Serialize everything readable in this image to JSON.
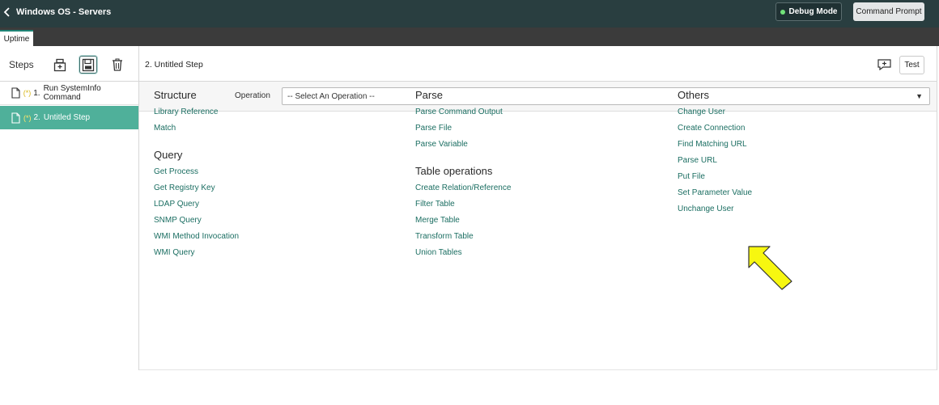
{
  "header": {
    "back_icon": "chevron-left-icon",
    "title": "Windows OS - Servers",
    "debug_mode": "Debug Mode",
    "debug_color": "#71e279",
    "command_prompt": "Command Prompt"
  },
  "tabs": [
    {
      "label": "Uptime",
      "active": true
    }
  ],
  "sidebar": {
    "label": "Steps",
    "tools": [
      "insert-step-icon",
      "save-step-icon",
      "trash-icon"
    ],
    "steps": [
      {
        "star": "(*)",
        "number": "1.",
        "name": "Run SystemInfo Command",
        "selected": false
      },
      {
        "star": "(*)",
        "number": "2.",
        "name": "Untitled Step",
        "selected": true
      }
    ]
  },
  "content": {
    "step_title": "2. Untitled Step",
    "test_label": "Test",
    "operation": {
      "label": "Operation",
      "selected": "-- Select An Operation --"
    },
    "sections": {
      "structure": {
        "title": "Structure",
        "links": [
          "Library Reference",
          "Match"
        ]
      },
      "query": {
        "title": "Query",
        "links": [
          "Get Process",
          "Get Registry Key",
          "LDAP Query",
          "SNMP Query",
          "WMI Method Invocation",
          "WMI Query"
        ]
      },
      "parse": {
        "title": "Parse",
        "links": [
          "Parse Command Output",
          "Parse File",
          "Parse Variable"
        ]
      },
      "table_ops": {
        "title": "Table operations",
        "links": [
          "Create Relation/Reference",
          "Filter Table",
          "Merge Table",
          "Transform Table",
          "Union Tables"
        ]
      },
      "others": {
        "title": "Others",
        "links": [
          "Change User",
          "Create Connection",
          "Find Matching URL",
          "Parse URL",
          "Put File",
          "Set Parameter Value",
          "Unchange User"
        ]
      }
    }
  },
  "colors": {
    "header_bg": "#293e40",
    "accent": "#4fb09a",
    "link": "#1b6e62",
    "highlight_arrow": "#f7f710"
  }
}
